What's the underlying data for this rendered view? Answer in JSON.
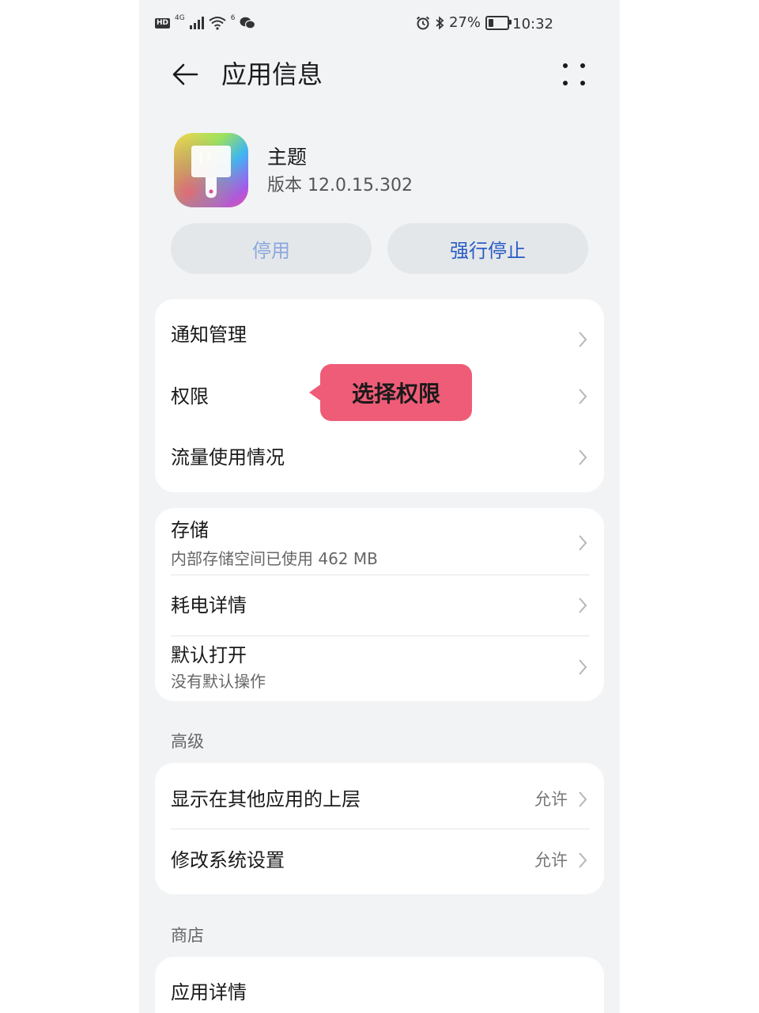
{
  "status_bar": {
    "signal_label": "4G",
    "wifi_label": "6",
    "battery_percent_text": "27%",
    "battery_level": 0.27,
    "time": "10:32"
  },
  "header": {
    "title": "应用信息"
  },
  "app": {
    "name": "主题",
    "version": "版本 12.0.15.302"
  },
  "actions": {
    "disable_label": "停用",
    "force_stop_label": "强行停止"
  },
  "tooltip": {
    "text": "选择权限"
  },
  "group1": {
    "items": [
      {
        "title": "通知管理"
      },
      {
        "title": "权限"
      },
      {
        "title": "流量使用情况"
      }
    ]
  },
  "group2": {
    "items": [
      {
        "title": "存储",
        "subtitle": "内部存储空间已使用 462 MB"
      },
      {
        "title": "耗电详情"
      },
      {
        "title": "默认打开",
        "subtitle": "没有默认操作"
      }
    ]
  },
  "advanced": {
    "label": "高级",
    "items": [
      {
        "title": "显示在其他应用的上层",
        "value": "允许"
      },
      {
        "title": "修改系统设置",
        "value": "允许"
      }
    ]
  },
  "store": {
    "label": "商店",
    "items": [
      {
        "title": "应用详情"
      }
    ]
  },
  "colors": {
    "background": "#f1f3f5",
    "accent_blue": "#2a5cc5",
    "tooltip_pink": "#ef5c78"
  }
}
